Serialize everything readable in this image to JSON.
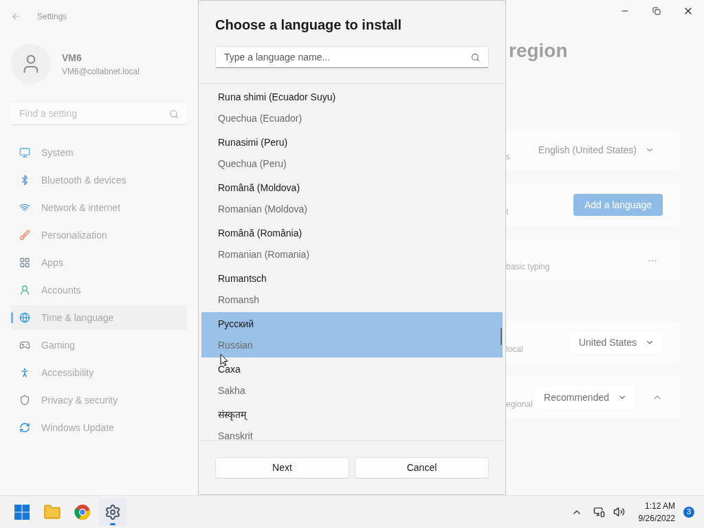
{
  "window": {
    "title": "Settings"
  },
  "account": {
    "name": "VM6",
    "email": "VM6@collabnet.local"
  },
  "search": {
    "placeholder": "Find a setting"
  },
  "sidebar": {
    "items": [
      {
        "label": "System",
        "selected": false
      },
      {
        "label": "Bluetooth & devices",
        "selected": false
      },
      {
        "label": "Network & internet",
        "selected": false
      },
      {
        "label": "Personalization",
        "selected": false
      },
      {
        "label": "Apps",
        "selected": false
      },
      {
        "label": "Accounts",
        "selected": false
      },
      {
        "label": "Time & language",
        "selected": true
      },
      {
        "label": "Gaming",
        "selected": false
      },
      {
        "label": "Accessibility",
        "selected": false
      },
      {
        "label": "Privacy & security",
        "selected": false
      },
      {
        "label": "Windows Update",
        "selected": false
      }
    ]
  },
  "page": {
    "title": "region",
    "rows": [
      {
        "kind": "dropdown",
        "label": "s",
        "value": "English (United States)",
        "disabled": true
      },
      {
        "kind": "button",
        "label": "t",
        "value": "Add a language"
      },
      {
        "kind": "more",
        "label": "basic typing",
        "value": "···"
      },
      {
        "kind": "dropdown",
        "label": "local",
        "value": "United States",
        "disabled": false
      },
      {
        "kind": "dropdown",
        "label": "egional",
        "value": "Recommended",
        "disabled": false,
        "expanded": true
      }
    ]
  },
  "dialog": {
    "title": "Choose a language to install",
    "search": {
      "placeholder": "Type a language name..."
    },
    "languages": [
      {
        "name": "Runa shimi (Ecuador Suyu)",
        "english": "Quechua (Ecuador)",
        "selected": false
      },
      {
        "name": "Runasimi (Peru)",
        "english": "Quechua (Peru)",
        "selected": false
      },
      {
        "name": "Română (Moldova)",
        "english": "Romanian (Moldova)",
        "selected": false
      },
      {
        "name": "Română (România)",
        "english": "Romanian (Romania)",
        "selected": false
      },
      {
        "name": "Rumantsch",
        "english": "Romansh",
        "selected": false
      },
      {
        "name": "Русский",
        "english": "Russian",
        "selected": true
      },
      {
        "name": "Саха",
        "english": "Sakha",
        "selected": false
      },
      {
        "name": "संस्कृतम्",
        "english": "Sanskrit",
        "selected": false
      }
    ],
    "buttons": [
      "Next",
      "Cancel"
    ]
  },
  "taskbar": {
    "apps": [
      {
        "active": false
      },
      {
        "active": false
      },
      {
        "active": false
      },
      {
        "active": true
      }
    ],
    "time": "1:12 AM",
    "date": "9/26/2022",
    "notifications": "3"
  }
}
